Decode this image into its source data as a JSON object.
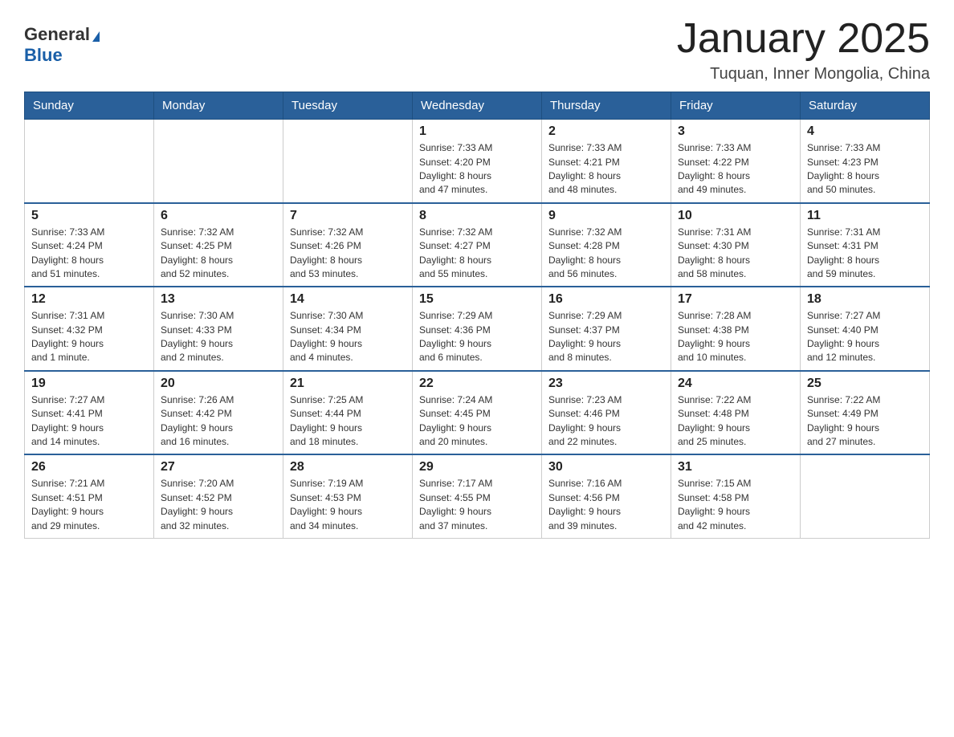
{
  "logo": {
    "general": "General",
    "blue": "Blue",
    "triangle": "▶"
  },
  "title": "January 2025",
  "subtitle": "Tuquan, Inner Mongolia, China",
  "days_of_week": [
    "Sunday",
    "Monday",
    "Tuesday",
    "Wednesday",
    "Thursday",
    "Friday",
    "Saturday"
  ],
  "weeks": [
    {
      "days": [
        {
          "number": "",
          "info": ""
        },
        {
          "number": "",
          "info": ""
        },
        {
          "number": "",
          "info": ""
        },
        {
          "number": "1",
          "info": "Sunrise: 7:33 AM\nSunset: 4:20 PM\nDaylight: 8 hours\nand 47 minutes."
        },
        {
          "number": "2",
          "info": "Sunrise: 7:33 AM\nSunset: 4:21 PM\nDaylight: 8 hours\nand 48 minutes."
        },
        {
          "number": "3",
          "info": "Sunrise: 7:33 AM\nSunset: 4:22 PM\nDaylight: 8 hours\nand 49 minutes."
        },
        {
          "number": "4",
          "info": "Sunrise: 7:33 AM\nSunset: 4:23 PM\nDaylight: 8 hours\nand 50 minutes."
        }
      ]
    },
    {
      "days": [
        {
          "number": "5",
          "info": "Sunrise: 7:33 AM\nSunset: 4:24 PM\nDaylight: 8 hours\nand 51 minutes."
        },
        {
          "number": "6",
          "info": "Sunrise: 7:32 AM\nSunset: 4:25 PM\nDaylight: 8 hours\nand 52 minutes."
        },
        {
          "number": "7",
          "info": "Sunrise: 7:32 AM\nSunset: 4:26 PM\nDaylight: 8 hours\nand 53 minutes."
        },
        {
          "number": "8",
          "info": "Sunrise: 7:32 AM\nSunset: 4:27 PM\nDaylight: 8 hours\nand 55 minutes."
        },
        {
          "number": "9",
          "info": "Sunrise: 7:32 AM\nSunset: 4:28 PM\nDaylight: 8 hours\nand 56 minutes."
        },
        {
          "number": "10",
          "info": "Sunrise: 7:31 AM\nSunset: 4:30 PM\nDaylight: 8 hours\nand 58 minutes."
        },
        {
          "number": "11",
          "info": "Sunrise: 7:31 AM\nSunset: 4:31 PM\nDaylight: 8 hours\nand 59 minutes."
        }
      ]
    },
    {
      "days": [
        {
          "number": "12",
          "info": "Sunrise: 7:31 AM\nSunset: 4:32 PM\nDaylight: 9 hours\nand 1 minute."
        },
        {
          "number": "13",
          "info": "Sunrise: 7:30 AM\nSunset: 4:33 PM\nDaylight: 9 hours\nand 2 minutes."
        },
        {
          "number": "14",
          "info": "Sunrise: 7:30 AM\nSunset: 4:34 PM\nDaylight: 9 hours\nand 4 minutes."
        },
        {
          "number": "15",
          "info": "Sunrise: 7:29 AM\nSunset: 4:36 PM\nDaylight: 9 hours\nand 6 minutes."
        },
        {
          "number": "16",
          "info": "Sunrise: 7:29 AM\nSunset: 4:37 PM\nDaylight: 9 hours\nand 8 minutes."
        },
        {
          "number": "17",
          "info": "Sunrise: 7:28 AM\nSunset: 4:38 PM\nDaylight: 9 hours\nand 10 minutes."
        },
        {
          "number": "18",
          "info": "Sunrise: 7:27 AM\nSunset: 4:40 PM\nDaylight: 9 hours\nand 12 minutes."
        }
      ]
    },
    {
      "days": [
        {
          "number": "19",
          "info": "Sunrise: 7:27 AM\nSunset: 4:41 PM\nDaylight: 9 hours\nand 14 minutes."
        },
        {
          "number": "20",
          "info": "Sunrise: 7:26 AM\nSunset: 4:42 PM\nDaylight: 9 hours\nand 16 minutes."
        },
        {
          "number": "21",
          "info": "Sunrise: 7:25 AM\nSunset: 4:44 PM\nDaylight: 9 hours\nand 18 minutes."
        },
        {
          "number": "22",
          "info": "Sunrise: 7:24 AM\nSunset: 4:45 PM\nDaylight: 9 hours\nand 20 minutes."
        },
        {
          "number": "23",
          "info": "Sunrise: 7:23 AM\nSunset: 4:46 PM\nDaylight: 9 hours\nand 22 minutes."
        },
        {
          "number": "24",
          "info": "Sunrise: 7:22 AM\nSunset: 4:48 PM\nDaylight: 9 hours\nand 25 minutes."
        },
        {
          "number": "25",
          "info": "Sunrise: 7:22 AM\nSunset: 4:49 PM\nDaylight: 9 hours\nand 27 minutes."
        }
      ]
    },
    {
      "days": [
        {
          "number": "26",
          "info": "Sunrise: 7:21 AM\nSunset: 4:51 PM\nDaylight: 9 hours\nand 29 minutes."
        },
        {
          "number": "27",
          "info": "Sunrise: 7:20 AM\nSunset: 4:52 PM\nDaylight: 9 hours\nand 32 minutes."
        },
        {
          "number": "28",
          "info": "Sunrise: 7:19 AM\nSunset: 4:53 PM\nDaylight: 9 hours\nand 34 minutes."
        },
        {
          "number": "29",
          "info": "Sunrise: 7:17 AM\nSunset: 4:55 PM\nDaylight: 9 hours\nand 37 minutes."
        },
        {
          "number": "30",
          "info": "Sunrise: 7:16 AM\nSunset: 4:56 PM\nDaylight: 9 hours\nand 39 minutes."
        },
        {
          "number": "31",
          "info": "Sunrise: 7:15 AM\nSunset: 4:58 PM\nDaylight: 9 hours\nand 42 minutes."
        },
        {
          "number": "",
          "info": ""
        }
      ]
    }
  ]
}
